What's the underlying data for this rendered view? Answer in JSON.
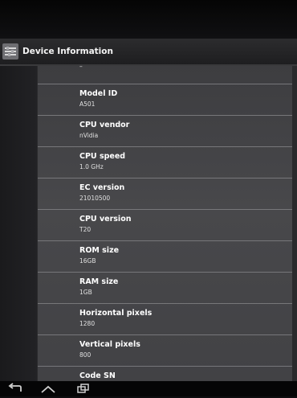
{
  "action_bar": {
    "title": "Device Information",
    "app_icon": "settings-app-icon"
  },
  "list": {
    "partial_item": {
      "value": "–"
    },
    "items": [
      {
        "label": "Model ID",
        "value": "A501"
      },
      {
        "label": "CPU vendor",
        "value": "nVidia"
      },
      {
        "label": "CPU speed",
        "value": "1.0 GHz"
      },
      {
        "label": "EC version",
        "value": "21010500"
      },
      {
        "label": "CPU version",
        "value": "T20"
      },
      {
        "label": "ROM size",
        "value": "16GB"
      },
      {
        "label": "RAM size",
        "value": "1GB"
      },
      {
        "label": "Horizontal pixels",
        "value": "1280"
      },
      {
        "label": "Vertical pixels",
        "value": "800"
      },
      {
        "label": "Code SN",
        "value": ""
      }
    ]
  },
  "nav": {
    "back_icon": "back-icon",
    "home_icon": "home-icon",
    "recents_icon": "recent-apps-icon"
  }
}
